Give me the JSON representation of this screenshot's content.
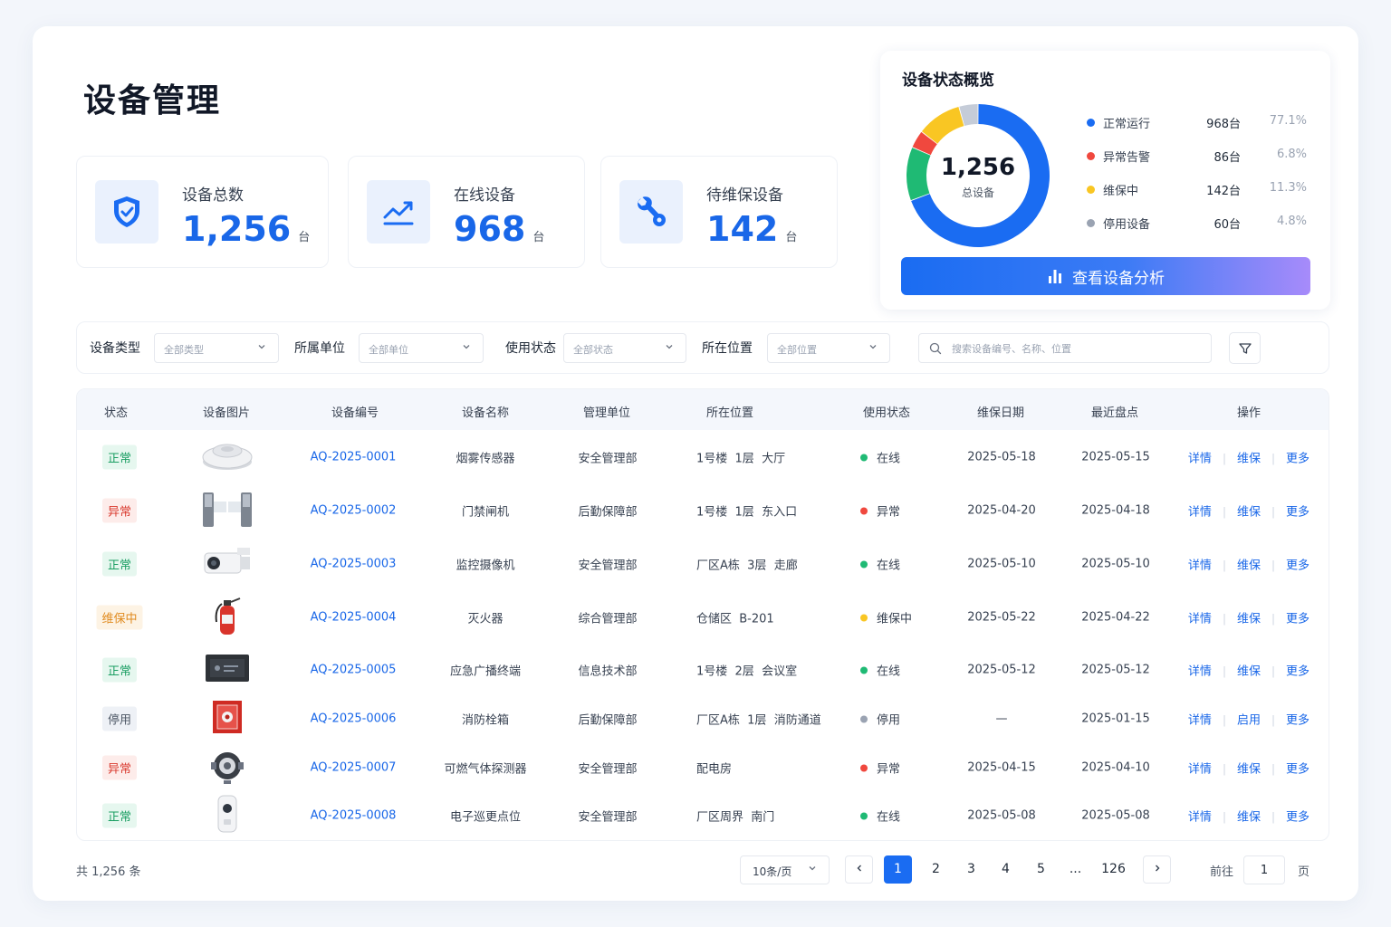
{
  "page": {
    "title": "设备管理"
  },
  "stats": [
    {
      "label": "设备总数",
      "value": "1,256",
      "unit": "台"
    },
    {
      "label": "在线设备",
      "value": "968",
      "unit": "台"
    },
    {
      "label": "待维保设备",
      "value": "142",
      "unit": "台"
    }
  ],
  "overview": {
    "title": "设备状态概览",
    "center_value": "1,256",
    "center_label": "总设备",
    "legend": [
      {
        "name": "正常运行",
        "count": "968台",
        "percent": "77.1%",
        "color": "#1a6cf2",
        "fraction": 0.771
      },
      {
        "name": "异常告警",
        "count": "86台",
        "percent": "6.8%",
        "color": "#f0483e",
        "fraction": 0.068
      },
      {
        "name": "维保中",
        "count": "142台",
        "percent": "11.3%",
        "color": "#f9c623",
        "fraction": 0.113
      },
      {
        "name": "停用设备",
        "count": "60台",
        "percent": "4.8%",
        "color": "#c5ccd8",
        "fraction": 0.048
      }
    ],
    "extra_segment_color": "#1fba74",
    "button_label": "查看设备分析"
  },
  "filters": {
    "type": {
      "label": "设备类型",
      "value": "全部类型"
    },
    "unit": {
      "label": "所属单位",
      "value": "全部单位"
    },
    "status": {
      "label": "使用状态",
      "value": "全部状态"
    },
    "location": {
      "label": "所在位置",
      "value": "全部位置"
    },
    "search_placeholder": "搜索设备编号、名称、位置"
  },
  "table": {
    "headers": [
      "状态",
      "设备图片",
      "设备编号",
      "设备名称",
      "管理单位",
      "所在位置",
      "使用状态",
      "维保日期",
      "最近盘点",
      "操作"
    ],
    "rows": [
      {
        "status": "正常",
        "status_kind": "normal",
        "image": "smoke-detector",
        "code": "AQ-2025-0001",
        "name": "烟雾传感器",
        "dept": "安全管理部",
        "location": "1号楼  1层  大厅",
        "use": "在线",
        "use_kind": "online",
        "maint": "2025-05-18",
        "check": "2025-05-15",
        "op1": "详情",
        "op2": "维保",
        "op3": "更多"
      },
      {
        "status": "异常",
        "status_kind": "abnormal",
        "image": "turnstile",
        "code": "AQ-2025-0002",
        "name": "门禁闸机",
        "dept": "后勤保障部",
        "location": "1号楼  1层  东入口",
        "use": "异常",
        "use_kind": "abnormal",
        "maint": "2025-04-20",
        "check": "2025-04-18",
        "op1": "详情",
        "op2": "维保",
        "op3": "更多"
      },
      {
        "status": "正常",
        "status_kind": "normal",
        "image": "camera",
        "code": "AQ-2025-0003",
        "name": "监控摄像机",
        "dept": "安全管理部",
        "location": "厂区A栋  3层  走廊",
        "use": "在线",
        "use_kind": "online",
        "maint": "2025-05-10",
        "check": "2025-05-10",
        "op1": "详情",
        "op2": "维保",
        "op3": "更多"
      },
      {
        "status": "维保中",
        "status_kind": "maint",
        "image": "fire-extinguisher",
        "code": "AQ-2025-0004",
        "name": "灭火器",
        "dept": "综合管理部",
        "location": "仓储区  B-201",
        "use": "维保中",
        "use_kind": "maint",
        "maint": "2025-05-22",
        "check": "2025-04-22",
        "op1": "详情",
        "op2": "维保",
        "op3": "更多"
      },
      {
        "status": "正常",
        "status_kind": "normal",
        "image": "broadcast-terminal",
        "code": "AQ-2025-0005",
        "name": "应急广播终端",
        "dept": "信息技术部",
        "location": "1号楼  2层  会议室",
        "use": "在线",
        "use_kind": "online",
        "maint": "2025-05-12",
        "check": "2025-05-12",
        "op1": "详情",
        "op2": "维保",
        "op3": "更多"
      },
      {
        "status": "停用",
        "status_kind": "stopped",
        "image": "hydrant-box",
        "code": "AQ-2025-0006",
        "name": "消防栓箱",
        "dept": "后勤保障部",
        "location": "厂区A栋  1层  消防通道",
        "use": "停用",
        "use_kind": "stopped",
        "maint": "—",
        "check": "2025-01-15",
        "op1": "详情",
        "op2": "启用",
        "op3": "更多"
      },
      {
        "status": "异常",
        "status_kind": "abnormal",
        "image": "gas-detector",
        "code": "AQ-2025-0007",
        "name": "可燃气体探测器",
        "dept": "安全管理部",
        "location": "配电房",
        "use": "异常",
        "use_kind": "abnormal",
        "maint": "2025-04-15",
        "check": "2025-04-10",
        "op1": "详情",
        "op2": "维保",
        "op3": "更多"
      },
      {
        "status": "正常",
        "status_kind": "normal",
        "image": "patrol-point",
        "code": "AQ-2025-0008",
        "name": "电子巡更点位",
        "dept": "安全管理部",
        "location": "厂区周界  南门",
        "use": "在线",
        "use_kind": "online",
        "maint": "2025-05-08",
        "check": "2025-05-08",
        "op1": "详情",
        "op2": "维保",
        "op3": "更多"
      }
    ]
  },
  "pagination": {
    "total": "共 1,256 条",
    "page_size": "10条/页",
    "pages": [
      "1",
      "2",
      "3",
      "4",
      "5",
      "...",
      "126"
    ],
    "current": "1",
    "goto_label": "前往",
    "goto_value": "1",
    "goto_suffix": "页"
  },
  "colors": {
    "primary": "#1a6cf2",
    "online": "#1fba74",
    "abnormal": "#f0483e",
    "maint": "#f9c623",
    "stopped": "#9aa3b2"
  }
}
